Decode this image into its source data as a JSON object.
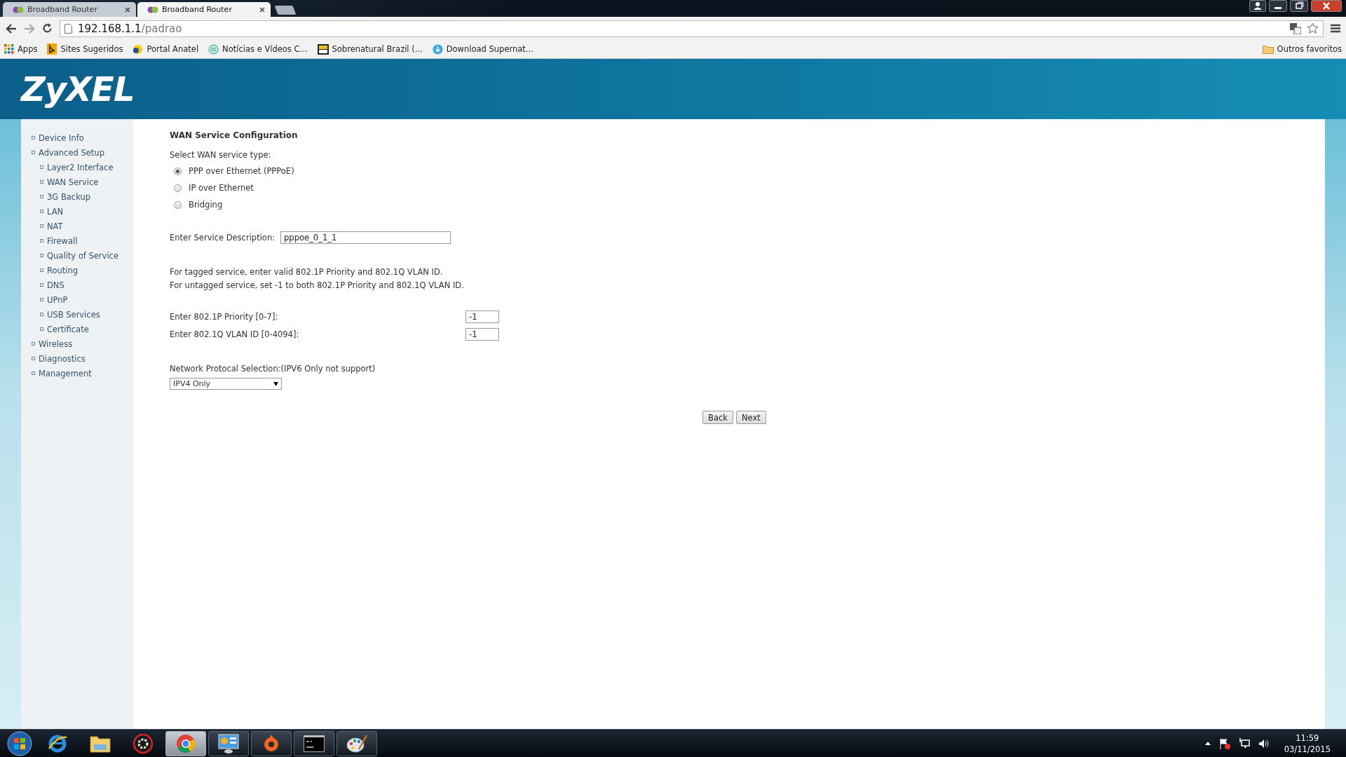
{
  "browser": {
    "tabs": [
      {
        "title": "Broadband Router",
        "selected": false
      },
      {
        "title": "Broadband Router",
        "selected": true
      }
    ],
    "address": {
      "host": "192.168.1.1",
      "path": "/padrao"
    },
    "bookmarks": [
      {
        "kind": "apps",
        "label": "Apps"
      },
      {
        "kind": "bing",
        "label": "Sites Sugeridos"
      },
      {
        "kind": "portal",
        "label": "Portal Anatel"
      },
      {
        "kind": "news",
        "label": "Notícias e Vídeos C..."
      },
      {
        "kind": "sb",
        "label": "Sobrenatural Brazil (..."
      },
      {
        "kind": "download",
        "label": "Download Supernat..."
      }
    ],
    "other_bookmarks": "Outros favoritos"
  },
  "header": {
    "logo": "ZyXEL"
  },
  "sidebar": {
    "items": [
      {
        "label": "Device Info"
      },
      {
        "label": "Advanced Setup",
        "children": [
          {
            "label": "Layer2 Interface"
          },
          {
            "label": "WAN Service"
          },
          {
            "label": "3G Backup"
          },
          {
            "label": "LAN"
          },
          {
            "label": "NAT"
          },
          {
            "label": "Firewall"
          },
          {
            "label": "Quality of Service"
          },
          {
            "label": "Routing"
          },
          {
            "label": "DNS"
          },
          {
            "label": "UPnP"
          },
          {
            "label": "USB Services"
          },
          {
            "label": "Certificate"
          }
        ]
      },
      {
        "label": "Wireless"
      },
      {
        "label": "Diagnostics"
      },
      {
        "label": "Management"
      }
    ]
  },
  "form": {
    "title": "WAN Service Configuration",
    "service_type_label": "Select WAN service type:",
    "service_types": [
      {
        "label": "PPP over Ethernet (PPPoE)",
        "selected": true
      },
      {
        "label": "IP over Ethernet",
        "selected": false
      },
      {
        "label": "Bridging",
        "selected": false
      }
    ],
    "description": {
      "label": "Enter Service Description:",
      "value": "pppoe_0_1_1"
    },
    "notes": [
      "For tagged service, enter valid 802.1P Priority and 802.1Q VLAN ID.",
      "For untagged service, set -1 to both 802.1P Priority and 802.1Q VLAN ID."
    ],
    "priority": {
      "label": "Enter 802.1P Priority [0-7]:",
      "value": "-1"
    },
    "vlan_id": {
      "label": "Enter 802.1Q VLAN ID [0-4094]:",
      "value": "-1"
    },
    "protocol": {
      "label": "Network Protocal Selection:(IPV6 Only not support)",
      "value": "IPV4 Only"
    },
    "buttons": [
      "Back",
      "Next"
    ]
  },
  "taskbar": {
    "apps": [
      {
        "kind": "ie",
        "running": false,
        "selected": false
      },
      {
        "kind": "explorer",
        "running": false,
        "selected": false
      },
      {
        "kind": "gear",
        "running": false,
        "selected": false
      },
      {
        "kind": "chrome",
        "running": true,
        "selected": true
      },
      {
        "kind": "panel",
        "running": true,
        "selected": false
      },
      {
        "kind": "origin",
        "running": true,
        "selected": false
      },
      {
        "kind": "cmd",
        "running": true,
        "selected": false
      },
      {
        "kind": "paint",
        "running": true,
        "selected": false
      }
    ],
    "time": "11:59",
    "date": "03/11/2015"
  }
}
